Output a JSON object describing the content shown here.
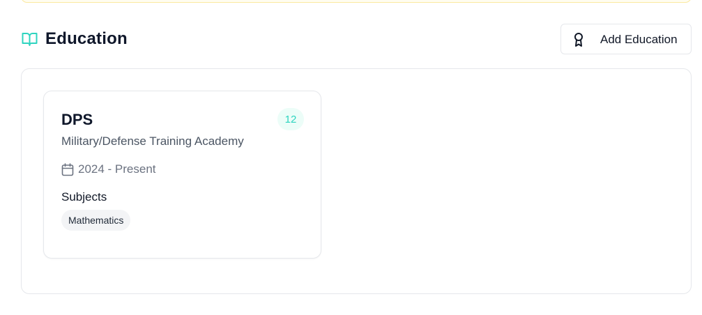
{
  "section": {
    "title": "Education",
    "icon": "book-open-icon",
    "accent_color": "#2dd4bf"
  },
  "actions": {
    "add_label": "Add Education",
    "add_icon": "award-icon"
  },
  "education": [
    {
      "institution": "DPS",
      "type": "Military/Defense Training Academy",
      "grade": "12",
      "period": "2024 - Present",
      "subjects_label": "Subjects",
      "subjects": [
        "Mathematics"
      ]
    }
  ]
}
